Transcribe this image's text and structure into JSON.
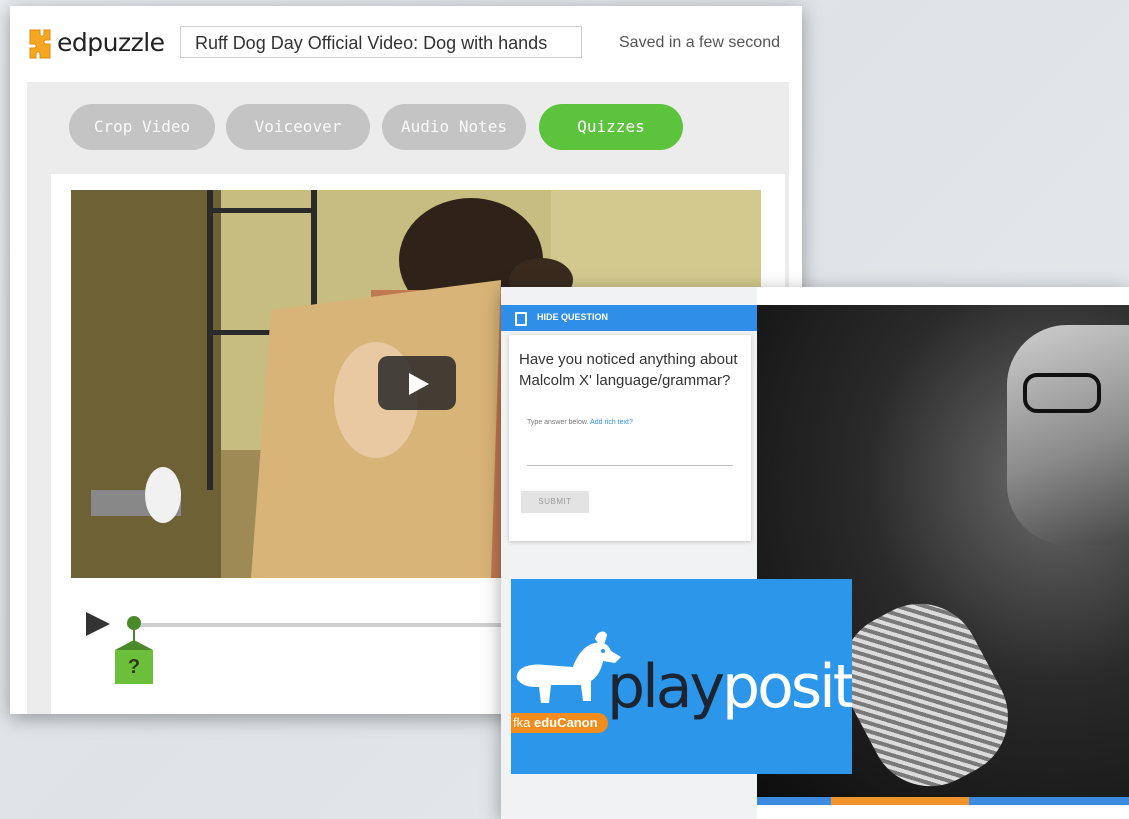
{
  "edpuzzle": {
    "brand": "edpuzzle",
    "video_title": "Ruff Dog Day Official Video: Dog with hands",
    "save_status": "Saved in a few second",
    "tabs": [
      {
        "label": "Crop Video",
        "active": false
      },
      {
        "label": "Voiceover",
        "active": false
      },
      {
        "label": "Audio Notes",
        "active": false
      },
      {
        "label": "Quizzes",
        "active": true
      }
    ],
    "question_marker": "?",
    "colors": {
      "accent": "#5cc33c",
      "tab_inactive": "#c4c4c4",
      "marker": "#6cbf3a"
    }
  },
  "playposit": {
    "hide_question": "HIDE QUESTION",
    "question": "Have you noticed anything about Malcolm X' language/grammar?",
    "answer_hint": "Type answer below.",
    "rich_text_link": "Add rich text?",
    "submit": "SUBMIT",
    "logo": {
      "play": "play",
      "posit": "posit",
      "fka": "fka ",
      "fka_brand": "eduCanon"
    },
    "colors": {
      "primary": "#2f8fe8",
      "logo_bg": "#2c97ea",
      "fka": "#f28c1c"
    }
  }
}
